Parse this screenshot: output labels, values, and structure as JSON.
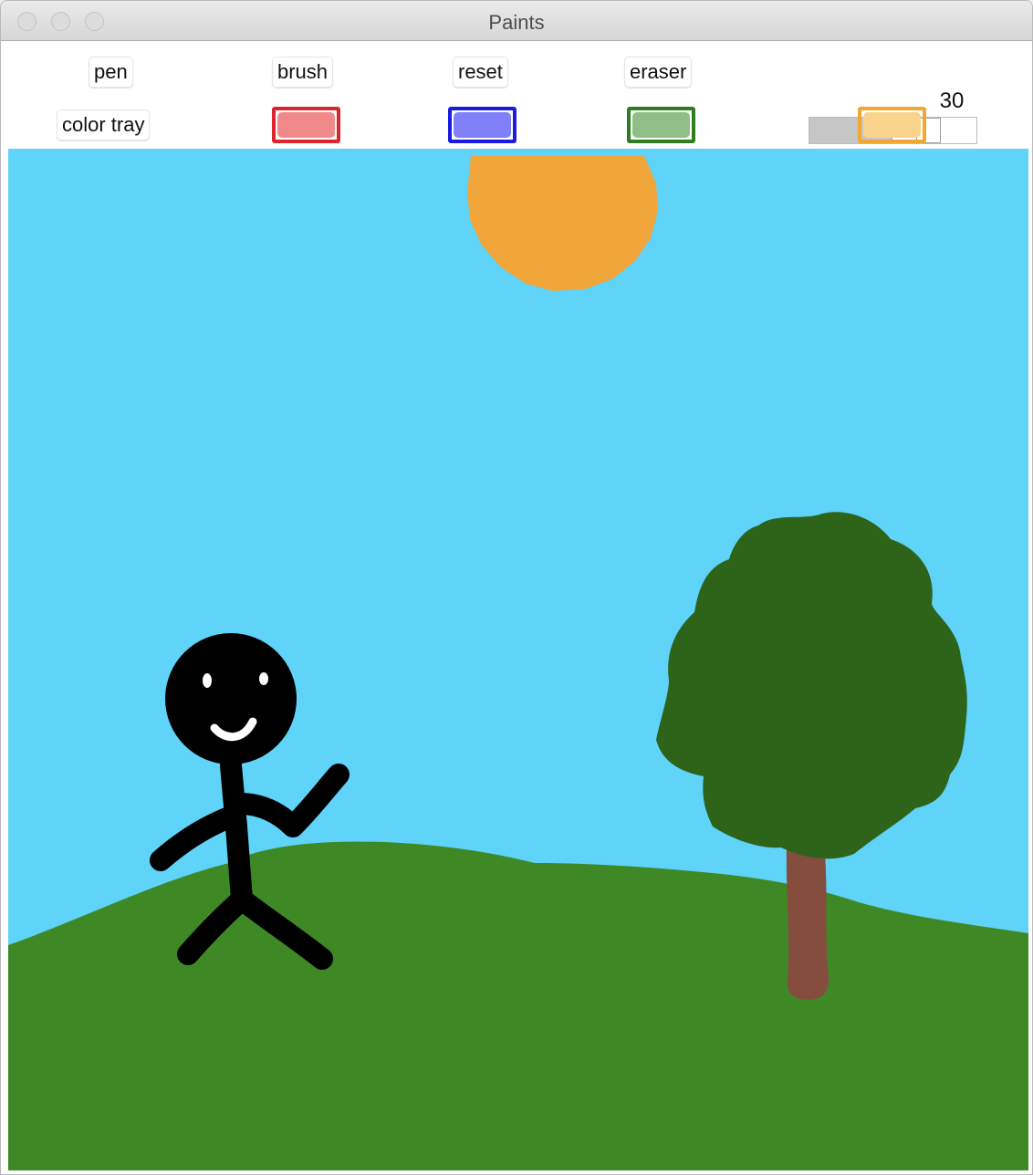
{
  "window": {
    "title": "Paints"
  },
  "toolbar": {
    "pen_label": "pen",
    "brush_label": "brush",
    "reset_label": "reset",
    "eraser_label": "eraser",
    "color_tray_label": "color tray"
  },
  "swatches": [
    {
      "name": "red",
      "border": "#e0242b",
      "fill": "#f08a8a"
    },
    {
      "name": "blue",
      "border": "#1a1ae0",
      "fill": "#8080f8"
    },
    {
      "name": "green",
      "border": "#2e7d1e",
      "fill": "#8fbf86"
    },
    {
      "name": "orange",
      "border": "#f0a830",
      "fill": "#fad48c"
    }
  ],
  "size_slider": {
    "value": "30",
    "fraction": 0.7
  },
  "colors": {
    "sky": "#5fd3f8",
    "grass": "#3e8925",
    "sun": "#f0a63a",
    "tree_foliage": "#2d6419",
    "tree_trunk": "#854d3e",
    "stick_figure": "#000000",
    "face": "#ffffff"
  }
}
